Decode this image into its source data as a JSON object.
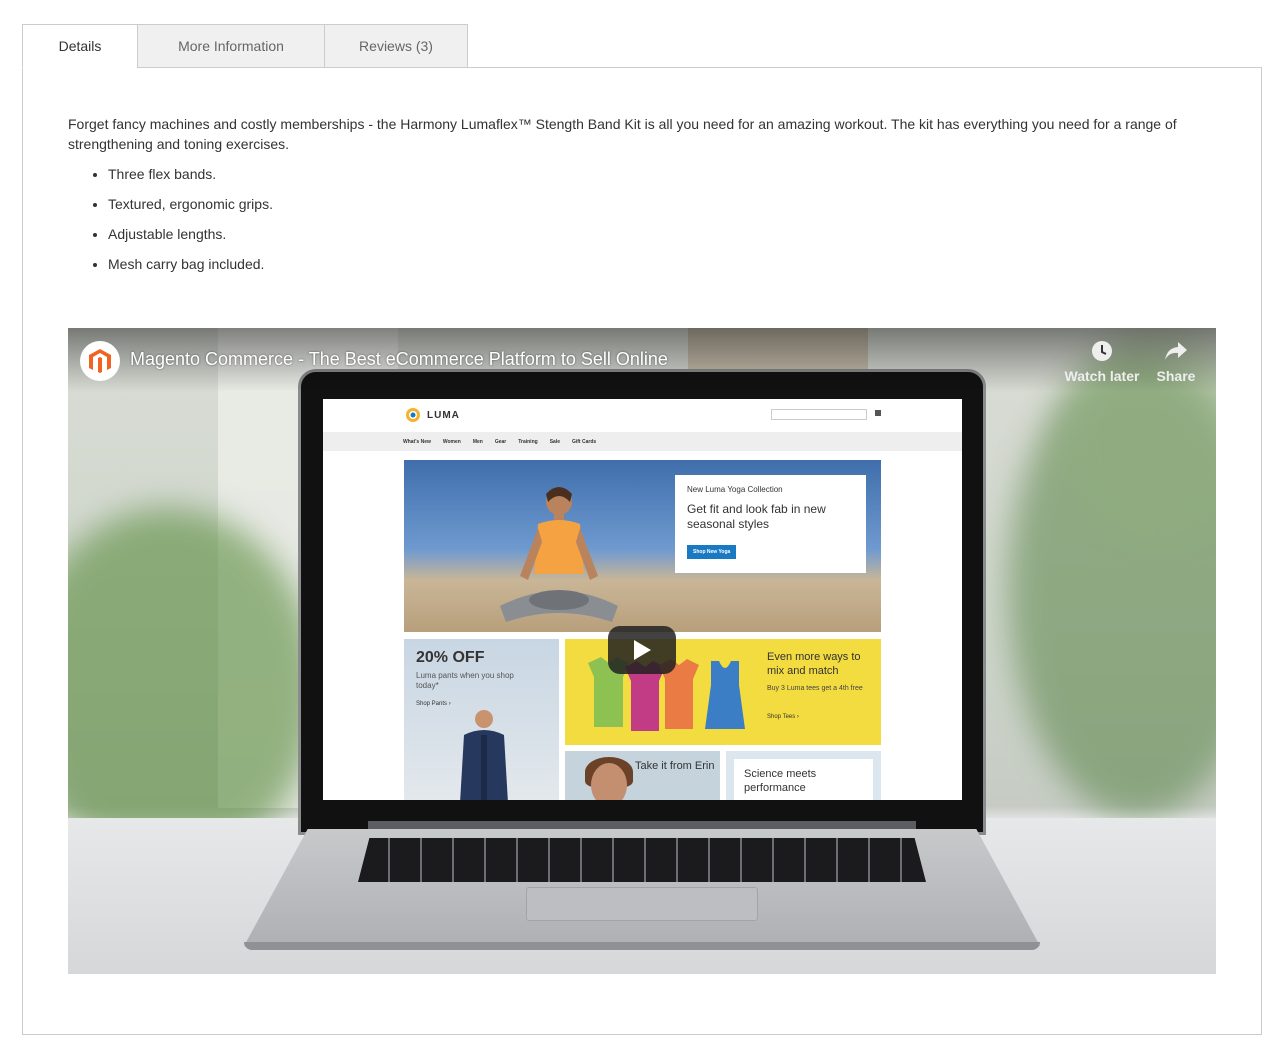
{
  "tabs": [
    {
      "label": "Details",
      "active": true
    },
    {
      "label": "More Information",
      "active": false
    },
    {
      "label": "Reviews (3)",
      "active": false
    }
  ],
  "details": {
    "description": "Forget fancy machines and costly memberships - the Harmony Lumaflex™ Stength Band Kit is all you need for an amazing workout. The kit has everything you need for a range of strengthening and toning exercises.",
    "features": [
      "Three flex bands.",
      "Textured, ergonomic grips.",
      "Adjustable lengths.",
      "Mesh carry bag included."
    ]
  },
  "video": {
    "title": "Magento Commerce - The Best eCommerce Platform to Sell Online",
    "channel_icon": "magento-logo-icon",
    "watch_later_label": "Watch later",
    "share_label": "Share",
    "play_icon": "play-icon",
    "screen": {
      "brand": "LUMA",
      "nav": [
        "What's New",
        "Women",
        "Men",
        "Gear",
        "Training",
        "Sale",
        "Gift Cards"
      ],
      "hero": {
        "kicker": "New Luma Yoga Collection",
        "heading": "Get fit and look fab in new seasonal styles",
        "button": "Shop New Yoga"
      },
      "promo_off": {
        "heading": "20% OFF",
        "sub": "Luma pants when you shop today*",
        "link": "Shop Pants ›"
      },
      "promo_tees": {
        "heading": "Even more ways to mix and match",
        "sub": "Buy 3 Luma tees get a 4th free",
        "link": "Shop Tees ›"
      },
      "promo_erin": {
        "heading": "Take it from Erin"
      },
      "promo_science": {
        "heading": "Science meets performance"
      }
    }
  },
  "colors": {
    "tab_border": "#cccccc",
    "text": "#333333",
    "magento_orange": "#f26322",
    "luma_blue": "#1979c3",
    "promo_yellow": "#f3dc3f"
  }
}
